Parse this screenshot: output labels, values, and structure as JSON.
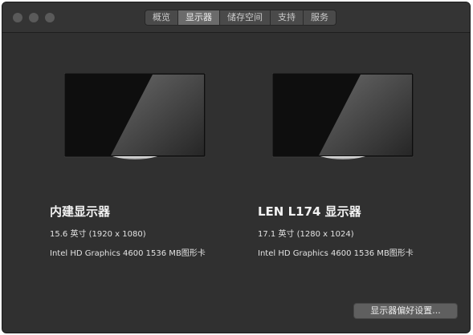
{
  "tabs": [
    {
      "label": "概览"
    },
    {
      "label": "显示器",
      "active": true
    },
    {
      "label": "储存空间"
    },
    {
      "label": "支持"
    },
    {
      "label": "服务"
    }
  ],
  "displays": [
    {
      "name": "内建显示器",
      "size": "15.6 英寸 (1920 x 1080)",
      "gpu": "Intel HD Graphics 4600 1536 MB图形卡"
    },
    {
      "name": "LEN L174 显示器",
      "size": "17.1 英寸 (1280 x 1024)",
      "gpu": "Intel HD Graphics 4600 1536 MB图形卡"
    }
  ],
  "prefs_button": {
    "label": "显示器偏好设置..."
  },
  "colors": {
    "window_bg": "#303030",
    "active_tab": "#6b6b6b"
  },
  "icons": [
    "display-icon"
  ]
}
